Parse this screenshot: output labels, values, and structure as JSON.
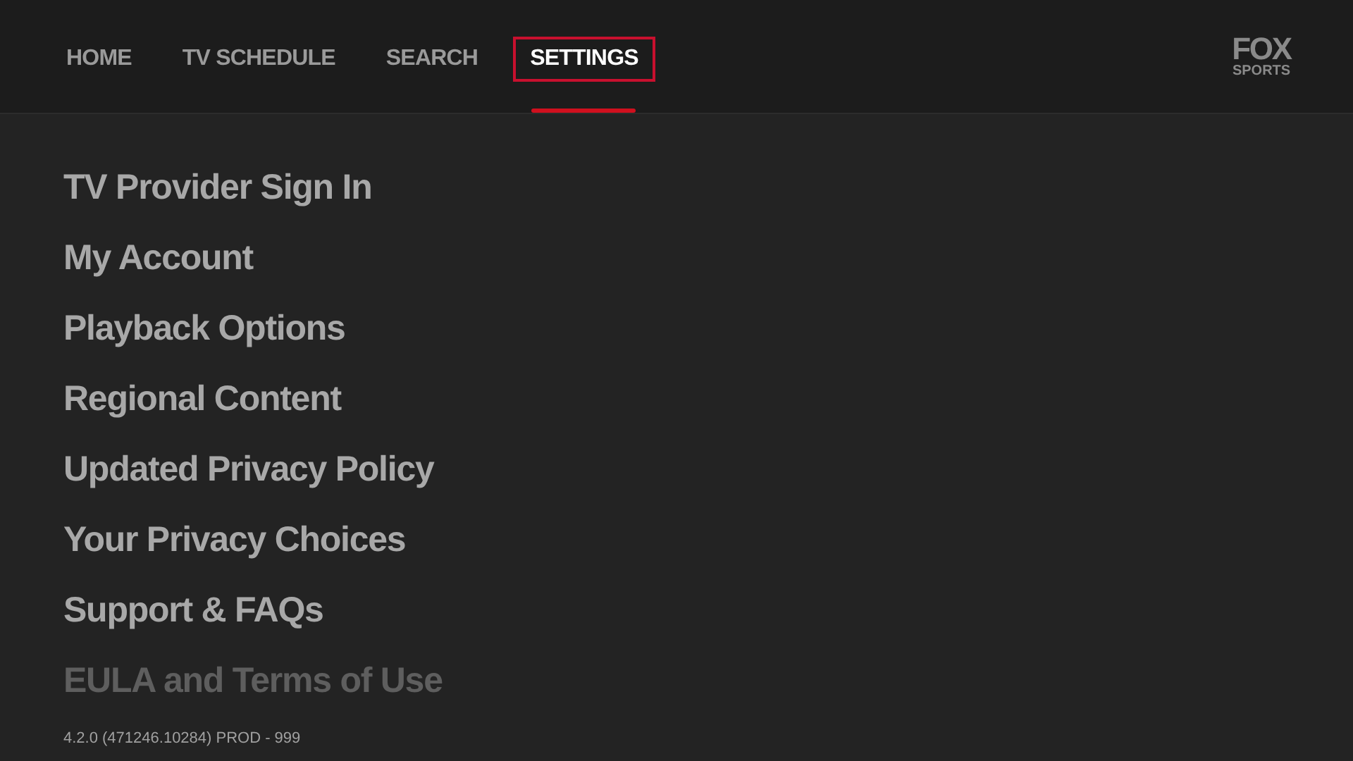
{
  "nav": {
    "tabs": [
      {
        "label": "HOME",
        "selected": false
      },
      {
        "label": "TV SCHEDULE",
        "selected": false
      },
      {
        "label": "SEARCH",
        "selected": false
      },
      {
        "label": "SETTINGS",
        "selected": true
      }
    ],
    "logo": [
      "FOX",
      "SPORTS"
    ]
  },
  "settings": [
    {
      "label": "TV Provider Sign In",
      "dimmed": false
    },
    {
      "label": "My Account",
      "dimmed": false
    },
    {
      "label": "Playback Options",
      "dimmed": false
    },
    {
      "label": "Regional Content",
      "dimmed": false
    },
    {
      "label": "Updated Privacy Policy",
      "dimmed": false
    },
    {
      "label": "Your Privacy Choices",
      "dimmed": false
    },
    {
      "label": "Support & FAQs",
      "dimmed": false
    },
    {
      "label": "EULA and Terms of Use",
      "dimmed": true
    }
  ],
  "version": "4.2.0 (471246.10284) PROD - 999"
}
